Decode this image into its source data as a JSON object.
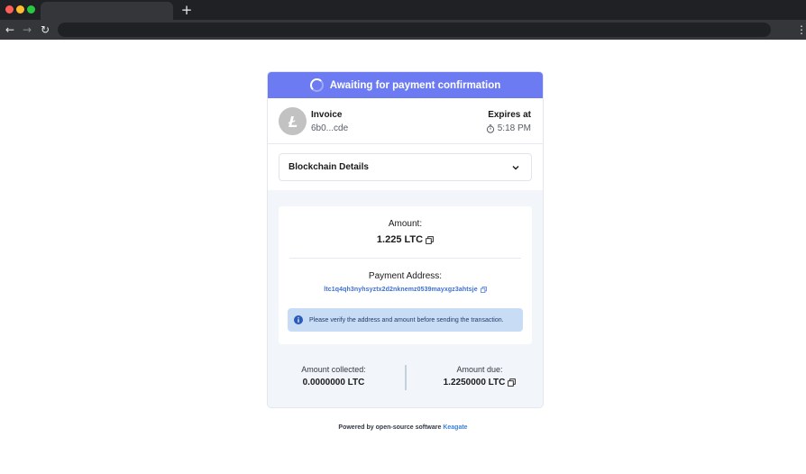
{
  "browser": {
    "new_tab_label": "+",
    "back_glyph": "←",
    "forward_glyph": "→",
    "reload_glyph": "↻",
    "menu_glyph": "⋮"
  },
  "status": {
    "text": "Awaiting for payment confirmation",
    "color": "#6c7bf2"
  },
  "invoice": {
    "label": "Invoice",
    "id": "6b0...cde",
    "expires_label": "Expires at",
    "expires_time": "5:18 PM",
    "coin_icon": "litecoin-icon"
  },
  "details": {
    "label": "Blockchain Details"
  },
  "payment": {
    "amount_label": "Amount:",
    "amount_value": "1.225 LTC",
    "address_label": "Payment Address:",
    "address_value": "ltc1q4qh3nyhsyztx2d2nknemz0539mayxgz3ahtsje",
    "notice_text": "Please verify the address and amount before sending the transaction."
  },
  "summary": {
    "collected_label": "Amount collected:",
    "collected_value": "0.0000000 LTC",
    "due_label": "Amount due:",
    "due_value": "1.2250000 LTC"
  },
  "footer": {
    "text": "Powered by open-source software",
    "link_text": "Keagate",
    "link_color": "#3b7fd9"
  }
}
